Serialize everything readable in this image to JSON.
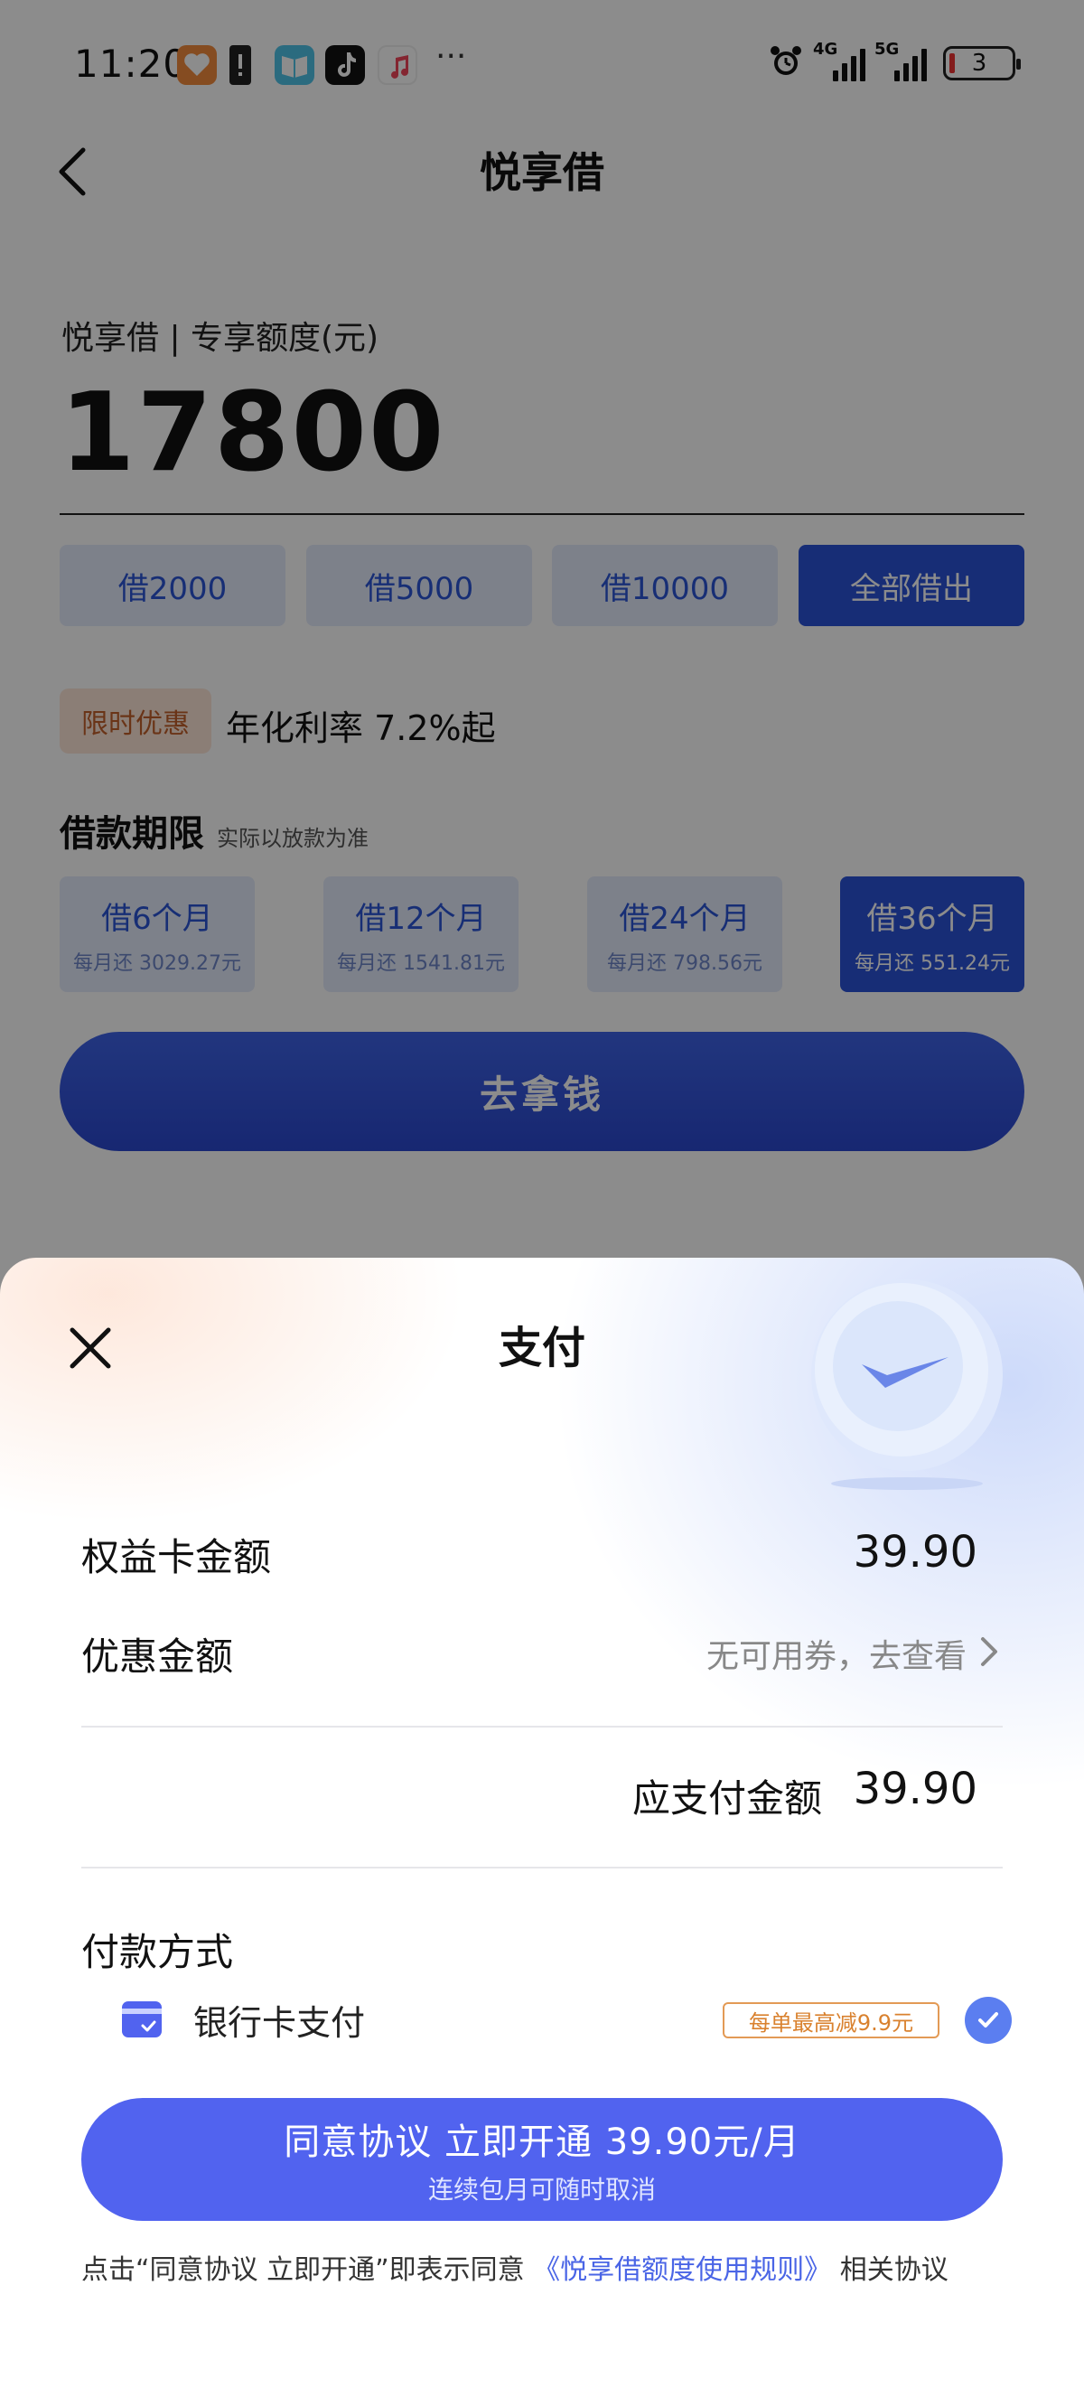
{
  "status_bar": {
    "time": "11:20",
    "more": "···",
    "signal_1_label": "4G",
    "signal_2_label": "5G",
    "battery_level": "3"
  },
  "header": {
    "back_icon": "chevron-left-icon",
    "title": "悦享借"
  },
  "quota": {
    "label": "悦享借 | 专享额度(元)",
    "amount": "17800"
  },
  "amount_options": [
    {
      "label": "借2000",
      "selected": false
    },
    {
      "label": "借5000",
      "selected": false
    },
    {
      "label": "借10000",
      "selected": false
    },
    {
      "label": "全部借出",
      "selected": true
    }
  ],
  "promo": {
    "tag": "限时优惠",
    "text": "年化利率 7.2%起"
  },
  "term": {
    "title": "借款期限",
    "note": "实际以放款为准",
    "options": [
      {
        "label": "借6个月",
        "monthly": "每月还 3029.27元",
        "selected": false
      },
      {
        "label": "借12个月",
        "monthly": "每月还 1541.81元",
        "selected": false
      },
      {
        "label": "借24个月",
        "monthly": "每月还 798.56元",
        "selected": false
      },
      {
        "label": "借36个月",
        "monthly": "每月还 551.24元",
        "selected": true
      }
    ]
  },
  "go_button": "去拿钱",
  "payment_sheet": {
    "title": "支付",
    "rows": {
      "card_amount_label": "权益卡金额",
      "card_amount_value": "39.90",
      "discount_label": "优惠金额",
      "discount_value": "无可用券，去查看",
      "payable_label": "应支付金额",
      "payable_value": "39.90"
    },
    "method_title": "付款方式",
    "method": {
      "label": "银行卡支付",
      "tag": "每单最高减9.9元",
      "selected": true
    },
    "cta": {
      "main": "同意协议 立即开通 39.90元/月",
      "sub": "连续包月可随时取消"
    },
    "agreement": {
      "prefix": "点击“同意协议 立即开通”即表示同意 ",
      "link": "《悦享借额度使用规则》",
      "suffix": " 相关协议"
    }
  },
  "colors": {
    "primary": "#2a52d8",
    "cta": "#5163ef",
    "tag_orange": "#d9812e",
    "chip_bg": "#e4ecfb"
  }
}
